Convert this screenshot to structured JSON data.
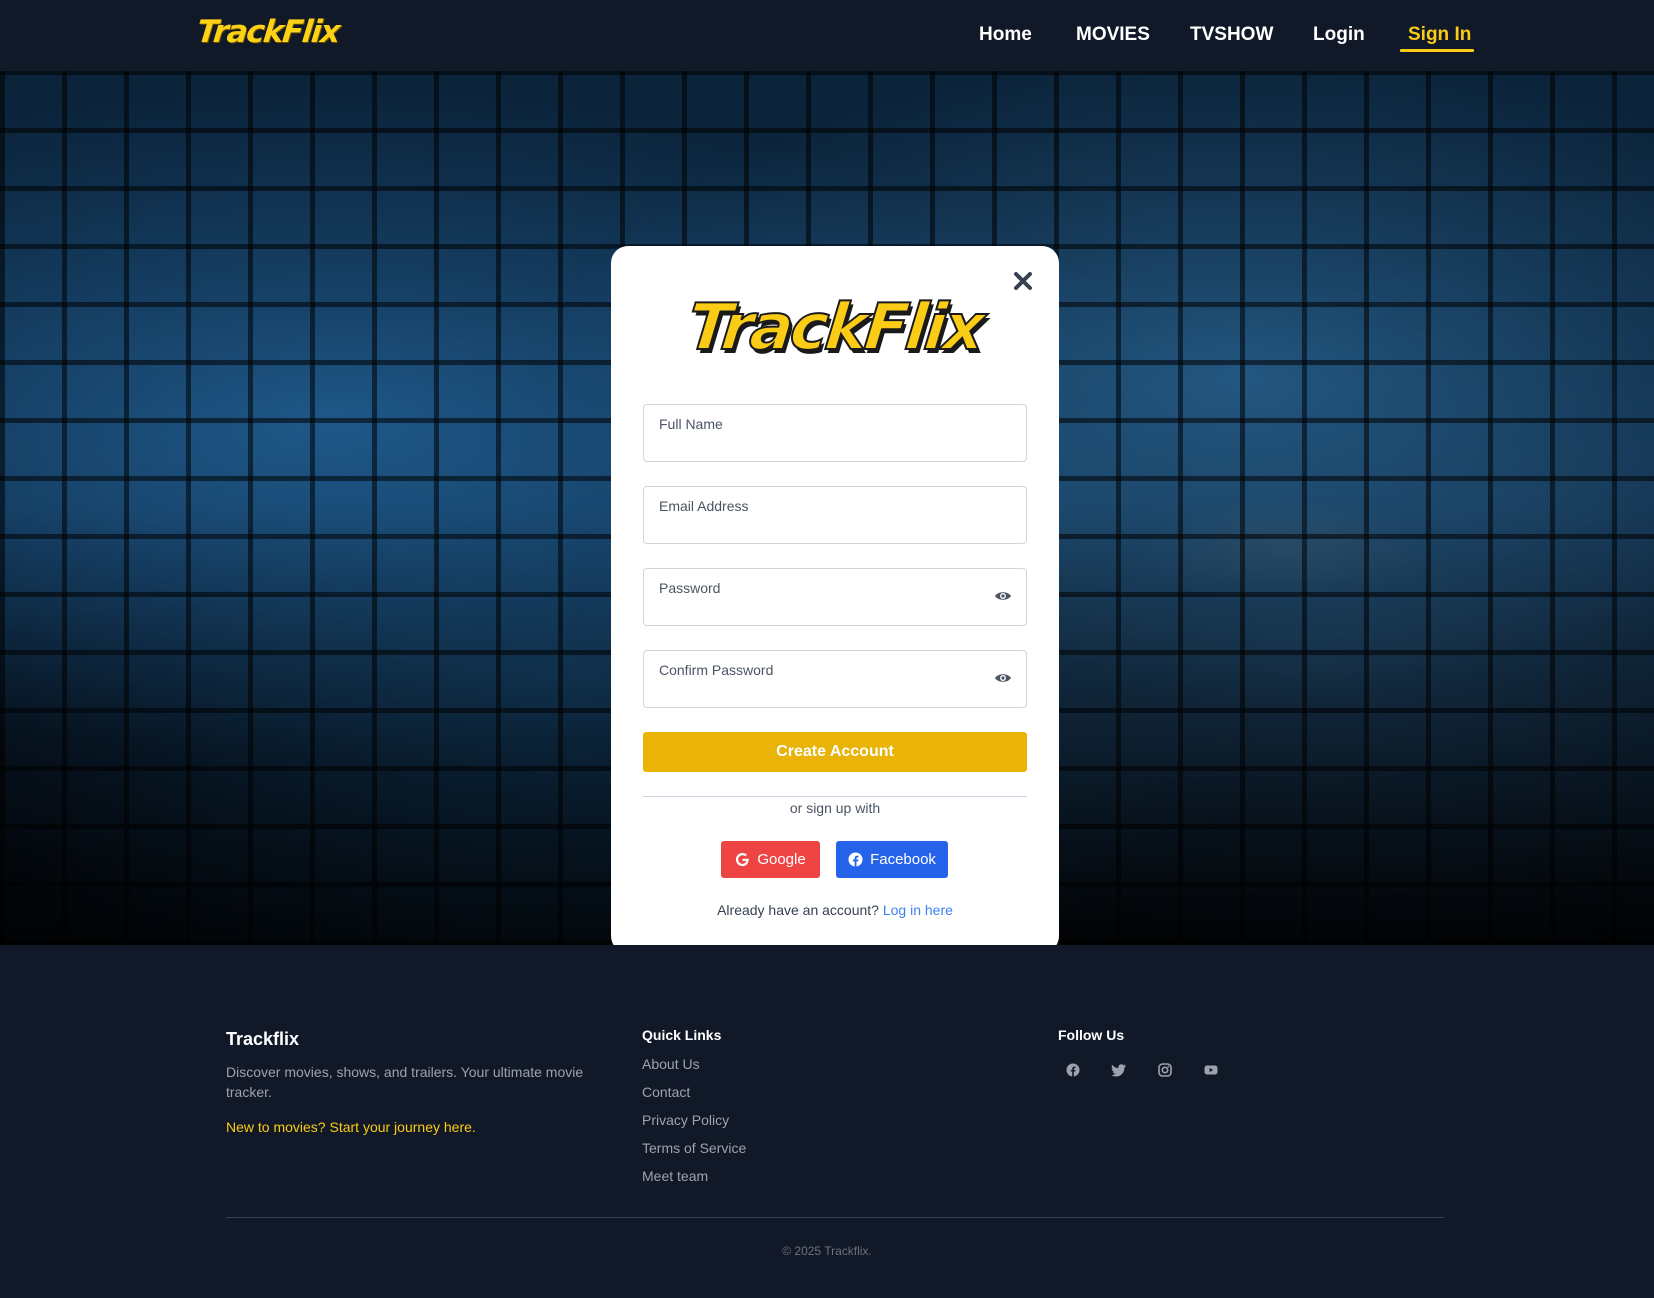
{
  "nav": {
    "logo": "TrackFlix",
    "links": [
      "Home",
      "MOVIES",
      "TVSHOW",
      "Login",
      "Sign In"
    ],
    "active": "Sign In"
  },
  "modal": {
    "logo": "TrackFlix",
    "close_icon": "close-icon",
    "fields": {
      "full_name": "Full Name",
      "email": "Email Address",
      "password": "Password",
      "confirm_password": "Confirm Password"
    },
    "create_button": "Create Account",
    "divider_text": "or sign up with",
    "google_button": "Google",
    "facebook_button": "Facebook",
    "login_prompt": "Already have an account?",
    "login_link": "Log in here"
  },
  "footer": {
    "brand": "Trackflix",
    "description": "Discover movies, shows, and trailers. Your ultimate movie tracker.",
    "cta": "New to movies? Start your journey here.",
    "quick_links_heading": "Quick Links",
    "quick_links": [
      "About Us",
      "Contact",
      "Privacy Policy",
      "Terms of Service",
      "Meet team"
    ],
    "follow_heading": "Follow Us",
    "social_icons": [
      "facebook-icon",
      "twitter-icon",
      "instagram-icon",
      "youtube-icon"
    ],
    "copyright": "© 2025 Trackflix."
  },
  "colors": {
    "accent": "#facc15",
    "navbar_bg": "#111827",
    "create_button": "#eab308",
    "google": "#ef4444",
    "facebook": "#2563eb",
    "link": "#3b82f6"
  }
}
